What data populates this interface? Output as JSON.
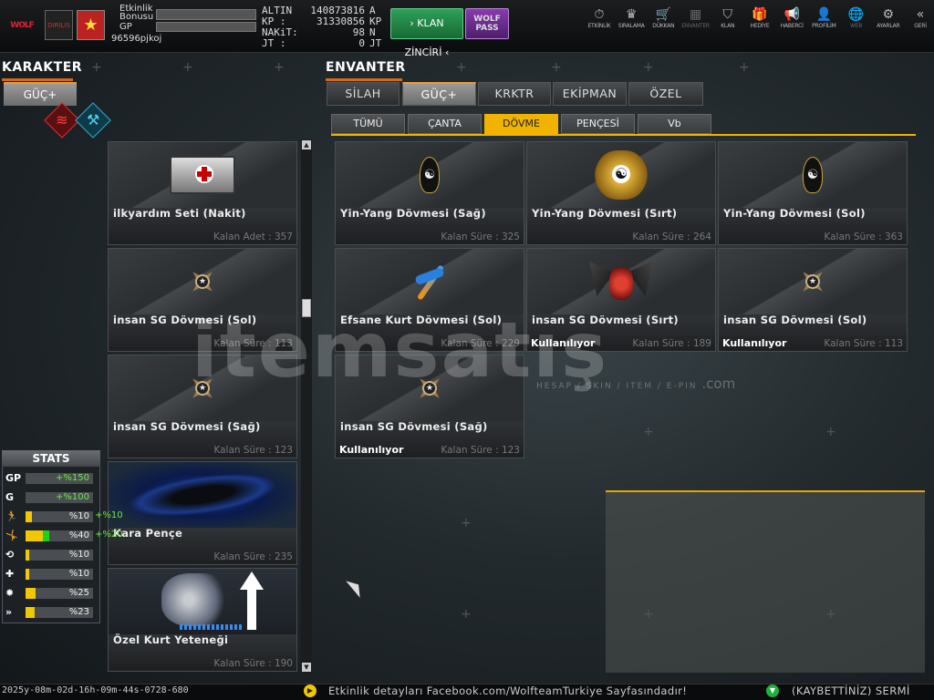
{
  "topbar": {
    "logo_text": "WOLF",
    "logo_sub": "DIRILIS",
    "event_bonus_label_1": "Etkinlik",
    "event_bonus_label_2": "Bonusu",
    "gp_label": "GP",
    "username": "96596pjkoj",
    "currencies": [
      {
        "label": "ALTIN",
        "value": "140873816",
        "unit": "A"
      },
      {
        "label": "KP    :",
        "value": "31330856",
        "unit": "KP"
      },
      {
        "label": "NAKiT:",
        "value": "98",
        "unit": "N"
      },
      {
        "label": "JT    :",
        "value": "0",
        "unit": "JT"
      }
    ],
    "klan_button": "KLAN ZİNCİRİ",
    "wolf_pass_1": "WOLF",
    "wolf_pass_2": "PASS"
  },
  "nav": [
    {
      "label": "ETKİNLİK",
      "icon": "stopwatch-icon",
      "glyph": "⏱",
      "dim": false
    },
    {
      "label": "SIRALAMA",
      "icon": "ranking-icon",
      "glyph": "♛",
      "dim": false
    },
    {
      "label": "DÜKKAN",
      "icon": "cart-icon",
      "glyph": "🛒",
      "dim": false
    },
    {
      "label": "ENVANTER",
      "icon": "inventory-icon",
      "glyph": "▦",
      "dim": true
    },
    {
      "label": "KLAN",
      "icon": "shield-icon",
      "glyph": "⛉",
      "dim": false
    },
    {
      "label": "HEDİYE",
      "icon": "gift-icon",
      "glyph": "🎁",
      "dim": false
    },
    {
      "label": "HABERCİ",
      "icon": "megaphone-icon",
      "glyph": "📢",
      "dim": false
    },
    {
      "label": "PROFİLİM",
      "icon": "profile-icon",
      "glyph": "👤",
      "dim": false
    },
    {
      "label": "WEB",
      "icon": "globe-icon",
      "glyph": "🌐",
      "dim": true
    },
    {
      "label": "AYARLAR",
      "icon": "gear-icon",
      "glyph": "⚙",
      "dim": false
    },
    {
      "label": "GERİ",
      "icon": "back-icon",
      "glyph": "«",
      "dim": false
    }
  ],
  "karakter": {
    "title": "KARAKTER",
    "guc_button": "GÜÇ+",
    "items": [
      {
        "name": "ilkyardım Seti (Nakit)",
        "sub": "Kalan Adet : 357",
        "icon": "firstaid-kit-icon"
      },
      {
        "name": "insan SG Dövmesi (Sol)",
        "sub": "Kalan Süre : 113",
        "icon": "sg-tattoo-icon"
      },
      {
        "name": "insan SG Dövmesi (Sağ)",
        "sub": "Kalan Süre : 123",
        "icon": "sg-tattoo-icon"
      },
      {
        "name": "Kara Pençe",
        "sub": "Kalan Süre : 235",
        "icon": "black-claw-icon"
      },
      {
        "name": "Özel Kurt Yeteneği",
        "sub": "Kalan Süre : 190",
        "icon": "wolf-skill-icon"
      }
    ]
  },
  "stats": {
    "title": "STATS",
    "rows": [
      {
        "icon": "GP",
        "value": "+%150",
        "fill": 0,
        "extra": "",
        "green": true
      },
      {
        "icon": "G",
        "value": "+%100",
        "fill": 0,
        "extra": "",
        "green": true
      },
      {
        "icon": "run-icon",
        "glyph": "🏃",
        "value": "%10",
        "fill": 0.1,
        "extra": "+%10",
        "green": false
      },
      {
        "icon": "jump-icon",
        "glyph": "🤸",
        "value": "%40",
        "fill": 0.25,
        "fill2": 0.1,
        "extra": "+%20",
        "green": false
      },
      {
        "icon": "reload-icon",
        "glyph": "⟲",
        "value": "%10",
        "fill": 0.06,
        "extra": "",
        "green": false
      },
      {
        "icon": "heal-icon",
        "glyph": "✚",
        "value": "%10",
        "fill": 0.06,
        "extra": "",
        "green": false
      },
      {
        "icon": "burst-icon",
        "glyph": "✹",
        "value": "%25",
        "fill": 0.15,
        "extra": "",
        "green": false
      },
      {
        "icon": "speed-icon",
        "glyph": "»",
        "value": "%23",
        "fill": 0.14,
        "extra": "",
        "green": false
      }
    ]
  },
  "envanter": {
    "title": "ENVANTER",
    "tabs": [
      "SİLAH",
      "GÜÇ+",
      "KRKTR",
      "EKİPMAN",
      "ÖZEL"
    ],
    "active_tab": 1,
    "subtabs": [
      "TÜMÜ",
      "ÇANTA",
      "DÖVME",
      "PENÇESİ",
      "Vb"
    ],
    "active_subtab": 2,
    "items": [
      {
        "name": "Yin-Yang Dövmesi (Sağ)",
        "sub": "Kalan Süre : 325",
        "used": "",
        "icon": "yin-yang-tattoo-icon"
      },
      {
        "name": "Yin-Yang Dövmesi (Sırt)",
        "sub": "Kalan Süre : 264",
        "used": "",
        "icon": "dragon-tattoo-icon"
      },
      {
        "name": "Yin-Yang Dövmesi (Sol)",
        "sub": "Kalan Süre : 363",
        "used": "",
        "icon": "yin-yang-tattoo-icon"
      },
      {
        "name": "Efsane Kurt Dövmesi (Sol)",
        "sub": "Kalan Süre : 229",
        "used": "",
        "icon": "legend-wolf-tattoo-icon"
      },
      {
        "name": "insan SG Dövmesi (Sırt)",
        "sub": "Kalan Süre : 189",
        "used": "Kullanılıyor",
        "icon": "winged-tattoo-icon"
      },
      {
        "name": "insan SG Dövmesi (Sol)",
        "sub": "Kalan Süre : 113",
        "used": "Kullanılıyor",
        "icon": "sg-tattoo-icon"
      },
      {
        "name": "insan SG Dövmesi (Sağ)",
        "sub": "Kalan Süre : 123",
        "used": "Kullanılıyor",
        "icon": "sg-tattoo-icon"
      }
    ]
  },
  "watermark": {
    "text": "itemsatış",
    "sub": "HESAP / SKIN / ITEM / E-PIN",
    "com": ".com"
  },
  "bottom": {
    "timestamp": "2025y-08m-02d-16h-09m-44s-0728-680",
    "message": "Etkinlik detayları Facebook.com/WolfteamTurkiye Sayfasındadır!",
    "message2": "(KAYBETTİNİZ) SERMİ"
  }
}
